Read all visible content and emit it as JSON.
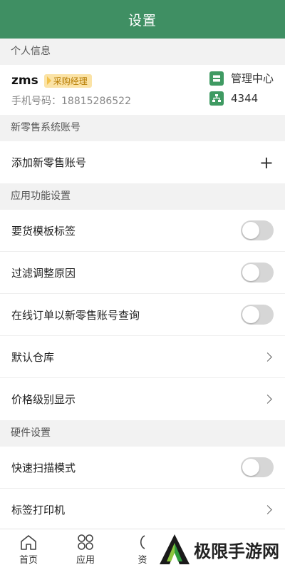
{
  "header": {
    "title": "设置"
  },
  "personal": {
    "section_title": "个人信息",
    "name": "zms",
    "role": "采购经理",
    "phone": "手机号码：18815286522",
    "mgmt_label": "管理中心",
    "org_label": "4344"
  },
  "retail": {
    "section_title": "新零售系统账号",
    "add_label": "添加新零售账号"
  },
  "app": {
    "section_title": "应用功能设置",
    "items": [
      {
        "label": "要货模板标签"
      },
      {
        "label": "过滤调整原因"
      },
      {
        "label": "在线订单以新零售账号查询"
      },
      {
        "label": "默认仓库"
      },
      {
        "label": "价格级别显示"
      }
    ]
  },
  "hardware": {
    "section_title": "硬件设置",
    "items": [
      {
        "label": "快速扫描模式"
      },
      {
        "label": "标签打印机"
      }
    ]
  },
  "tabbar": {
    "home": "首页",
    "apps": "应用",
    "res": "资"
  },
  "watermark": {
    "text": "极限手游网"
  }
}
